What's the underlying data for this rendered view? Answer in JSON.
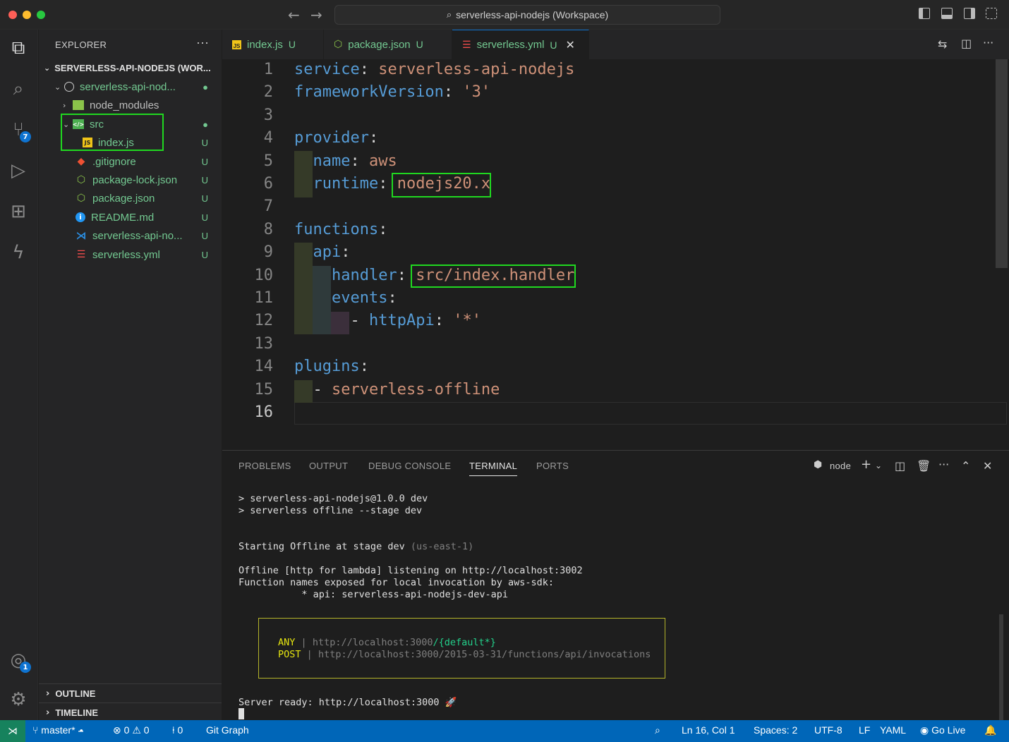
{
  "window": {
    "title": "serverless-api-nodejs (Workspace)"
  },
  "activity": {
    "scm_badge": "7",
    "account_badge": "1"
  },
  "sidebar": {
    "header": "EXPLORER",
    "more": "···",
    "workspace": "SERVERLESS-API-NODEJS (WOR...",
    "folder": "serverless-api-nod...",
    "items": [
      {
        "label": "node_modules",
        "status": "",
        "icon": "folder-node-icon"
      },
      {
        "label": "src",
        "status": "●",
        "icon": "folder-src-icon"
      },
      {
        "label": "index.js",
        "status": "U",
        "icon": "js-file-icon"
      },
      {
        "label": ".gitignore",
        "status": "U",
        "icon": "git-icon"
      },
      {
        "label": "package-lock.json",
        "status": "U",
        "icon": "npm-icon"
      },
      {
        "label": "package.json",
        "status": "U",
        "icon": "npm-icon"
      },
      {
        "label": "README.md",
        "status": "U",
        "icon": "info-icon"
      },
      {
        "label": "serverless-api-no...",
        "status": "U",
        "icon": "vscode-icon"
      },
      {
        "label": "serverless.yml",
        "status": "U",
        "icon": "yaml-icon"
      }
    ],
    "outline": "OUTLINE",
    "timeline": "TIMELINE"
  },
  "tabs": [
    {
      "label": "index.js",
      "status": "U"
    },
    {
      "label": "package.json",
      "status": "U"
    },
    {
      "label": "serverless.yml",
      "status": "U"
    }
  ],
  "editor": {
    "line_numbers": [
      "1",
      "2",
      "3",
      "4",
      "5",
      "6",
      "7",
      "8",
      "9",
      "10",
      "11",
      "12",
      "13",
      "14",
      "15",
      "16"
    ],
    "l1k": "service",
    "l1v": "serverless-api-nodejs",
    "l2k": "frameworkVersion",
    "l2v": "'3'",
    "l4k": "provider",
    "l5k": "name",
    "l5v": "aws",
    "l6k": "runtime",
    "l6v": "nodejs20.x",
    "l8k": "functions",
    "l9k": "api",
    "l10k": "handler",
    "l10v": "src/index.handler",
    "l11k": "events",
    "l12k": "httpApi",
    "l12v": "'*'",
    "l14k": "plugins",
    "l15v": "serverless-offline",
    "colon": ":",
    "dash": "-"
  },
  "panel": {
    "tabs": [
      "PROBLEMS",
      "OUTPUT",
      "DEBUG CONSOLE",
      "TERMINAL",
      "PORTS"
    ],
    "terminal_name": "node",
    "lines": {
      "t1": "> serverless-api-nodejs@1.0.0 dev",
      "t2": "> serverless offline --stage dev",
      "t3a": "Starting Offline at stage dev ",
      "t3b": "(us-east-1)",
      "t4": "Offline [http for lambda] listening on http://localhost:3002",
      "t5": "Function names exposed for local invocation by aws-sdk:",
      "t6": "           * api: serverless-api-nodejs-dev-api",
      "r1m": "ANY",
      "r1u": "http://localhost:3000",
      "r1p": "/{default*}",
      "r2m": "POST",
      "r2u": "http://localhost:3000/2015-03-31/functions/api/invocations",
      "sep": "|",
      "t7": "Server ready: http://localhost:3000 🚀"
    }
  },
  "statusbar": {
    "branch": "master*",
    "errors": "0",
    "warnings": "0",
    "ports": "0",
    "gitgraph": "Git Graph",
    "position": "Ln 16, Col 1",
    "spaces": "Spaces: 2",
    "encoding": "UTF-8",
    "eol": "LF",
    "language": "YAML",
    "golive": "Go Live"
  },
  "colors": {
    "accent": "#0066b8",
    "highlight": "#20d820",
    "untracked": "#73c991"
  }
}
